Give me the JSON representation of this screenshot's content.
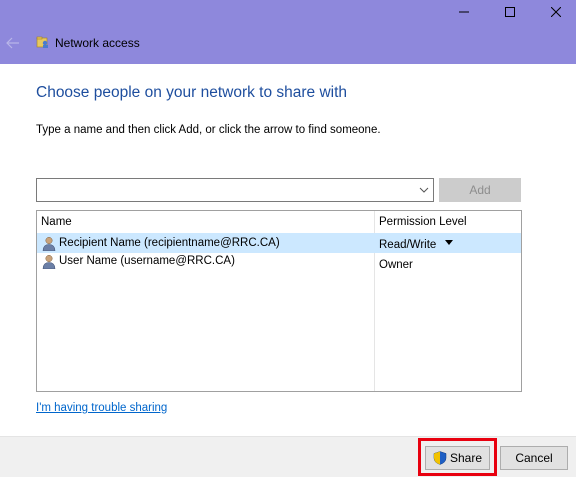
{
  "window": {
    "title": "Network access",
    "controls": [
      "minimize",
      "maximize",
      "close"
    ]
  },
  "main": {
    "heading": "Choose people on your network to share with",
    "instruction": "Type a name and then click Add, or click the arrow to find someone.",
    "name_input": {
      "value": "",
      "placeholder": ""
    },
    "add_label": "Add"
  },
  "list": {
    "columns": [
      "Name",
      "Permission Level"
    ],
    "rows": [
      {
        "name": "Recipient Name (recipientname@RRC.CA)",
        "permission": "Read/Write",
        "selected": true
      },
      {
        "name": "User Name (username@RRC.CA)",
        "permission": "Owner",
        "selected": false
      }
    ]
  },
  "trouble_link": "I'm having trouble sharing",
  "footer": {
    "share_label": "Share",
    "cancel_label": "Cancel"
  },
  "colors": {
    "titlebar": "#8e88dc",
    "heading": "#1e4e9e",
    "selected_row": "#cce8ff",
    "link": "#0066cc",
    "highlight": "#e8000f"
  }
}
